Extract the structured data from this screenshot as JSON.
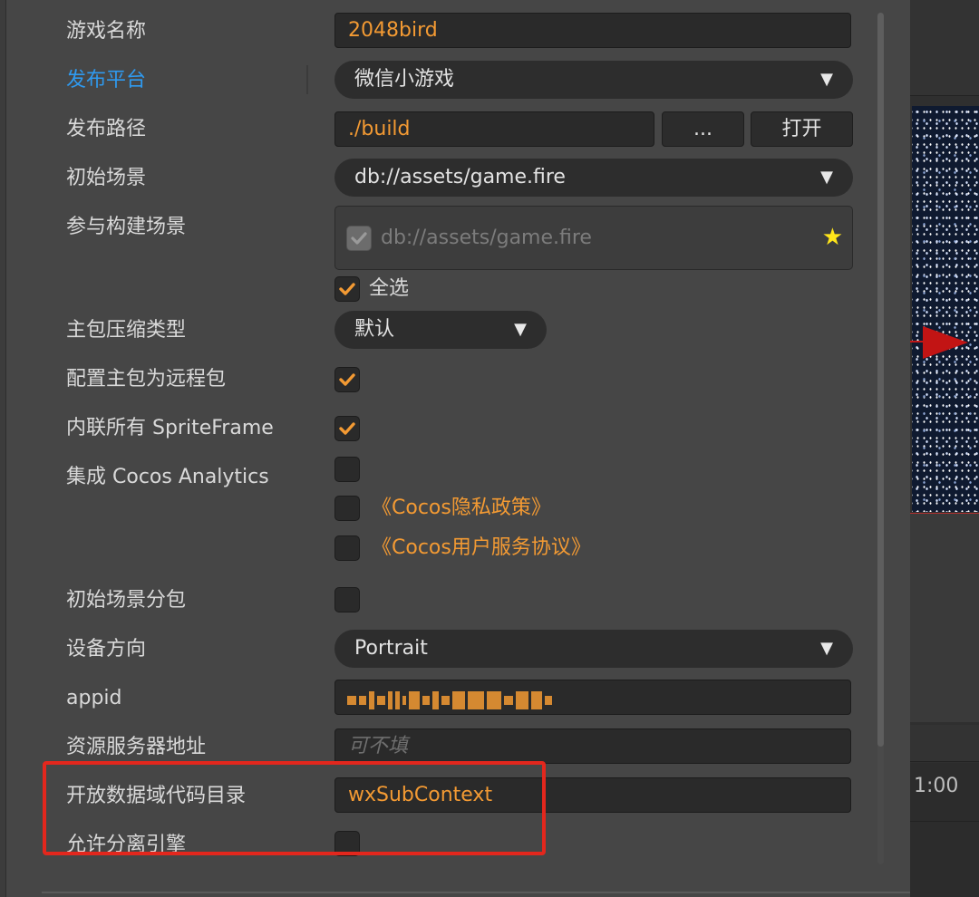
{
  "form": {
    "game_name": {
      "label": "游戏名称",
      "value": "2048bird"
    },
    "platform": {
      "label": "发布平台",
      "value": "微信小游戏"
    },
    "build_path": {
      "label": "发布路径",
      "value": "./build",
      "browse_label": "...",
      "open_label": "打开"
    },
    "start_scene": {
      "label": "初始场景",
      "value": "db://assets/game.fire"
    },
    "build_scenes": {
      "label": "参与构建场景",
      "items": [
        "db://assets/game.fire"
      ],
      "select_all_label": "全选"
    },
    "compression": {
      "label": "主包压缩类型",
      "value": "默认"
    },
    "remote_main_bundle": {
      "label": "配置主包为远程包"
    },
    "inline_spriteframe": {
      "label": "内联所有 SpriteFrame"
    },
    "analytics": {
      "label": "集成 Cocos Analytics",
      "privacy_link": "《Cocos隐私政策》",
      "service_link": "《Cocos用户服务协议》"
    },
    "start_scene_subpackage": {
      "label": "初始场景分包"
    },
    "orientation": {
      "label": "设备方向",
      "value": "Portrait"
    },
    "appid": {
      "label": "appid"
    },
    "remote_server": {
      "label": "资源服务器地址",
      "placeholder": "可不填"
    },
    "open_data_context": {
      "label": "开放数据域代码目录",
      "value": "wxSubContext"
    },
    "separate_engine": {
      "label": "允许分离引擎"
    }
  },
  "viewport": {
    "time_label": "1:00"
  },
  "icons": {
    "dropdown": "▼",
    "star": "★"
  },
  "colors": {
    "accent": "#f39a33",
    "active_label": "#2f9af0",
    "highlight": "#e3271d"
  }
}
